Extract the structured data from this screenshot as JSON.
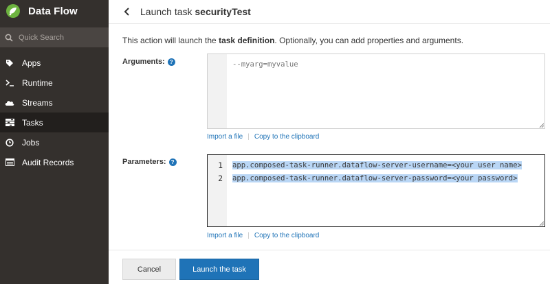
{
  "app": {
    "brand_title": "Data Flow"
  },
  "search": {
    "placeholder": "Quick Search"
  },
  "sidebar": {
    "items": [
      {
        "label": "Apps",
        "icon": "tags-icon",
        "active": false
      },
      {
        "label": "Runtime",
        "icon": "terminal-icon",
        "active": false
      },
      {
        "label": "Streams",
        "icon": "cloud-icon",
        "active": false
      },
      {
        "label": "Tasks",
        "icon": "tasks-icon",
        "active": true
      },
      {
        "label": "Jobs",
        "icon": "clock-icon",
        "active": false
      },
      {
        "label": "Audit Records",
        "icon": "list-icon",
        "active": false
      }
    ]
  },
  "header": {
    "title_prefix": "Launch task ",
    "task_name": "securityTest"
  },
  "intro": {
    "before": "This action will launch the ",
    "bold": "task definition",
    "after": ". Optionally, you can add properties and arguments."
  },
  "arguments": {
    "label": "Arguments:",
    "placeholder": "--myarg=myvalue",
    "import_link": "Import a file",
    "copy_link": "Copy to the clipboard"
  },
  "parameters": {
    "label": "Parameters:",
    "lines": [
      {
        "number": "1",
        "text": "app.composed-task-runner.dataflow-server-username=<your user name>"
      },
      {
        "number": "2",
        "text": "app.composed-task-runner.dataflow-server-password=<your password>"
      }
    ],
    "import_link": "Import a file",
    "copy_link": "Copy to the clipboard"
  },
  "footer": {
    "cancel_label": "Cancel",
    "launch_label": "Launch the task"
  },
  "colors": {
    "sidebar_bg": "#34302d",
    "accent": "#1f73b7",
    "selection": "#b9d6f5"
  }
}
